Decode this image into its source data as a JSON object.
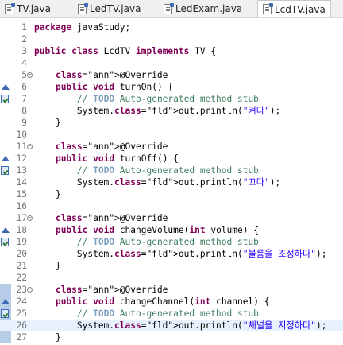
{
  "tabs": [
    {
      "label": "TV.java"
    },
    {
      "label": "LedTV.java"
    },
    {
      "label": "LedExam.java"
    },
    {
      "label": "LcdTV.java",
      "active": true
    }
  ],
  "lines": [
    {
      "num": "1",
      "code": "package javaStudy;"
    },
    {
      "num": "2",
      "code": ""
    },
    {
      "num": "3",
      "code": "public class LcdTV implements TV {"
    },
    {
      "num": "4",
      "code": ""
    },
    {
      "num": "5",
      "code": "    @Override"
    },
    {
      "num": "6",
      "code": "    public void turnOn() {"
    },
    {
      "num": "7",
      "code": "        // TODO Auto-generated method stub"
    },
    {
      "num": "8",
      "code": "        System.out.println(\"켜다\");"
    },
    {
      "num": "9",
      "code": "    }"
    },
    {
      "num": "10",
      "code": ""
    },
    {
      "num": "11",
      "code": "    @Override"
    },
    {
      "num": "12",
      "code": "    public void turnOff() {"
    },
    {
      "num": "13",
      "code": "        // TODO Auto-generated method stub"
    },
    {
      "num": "14",
      "code": "        System.out.println(\"끄다\");"
    },
    {
      "num": "15",
      "code": "    }"
    },
    {
      "num": "16",
      "code": ""
    },
    {
      "num": "17",
      "code": "    @Override"
    },
    {
      "num": "18",
      "code": "    public void changeVolume(int volume) {"
    },
    {
      "num": "19",
      "code": "        // TODO Auto-generated method stub"
    },
    {
      "num": "20",
      "code": "        System.out.println(\"볼륨을 조정하다\");"
    },
    {
      "num": "21",
      "code": "    }"
    },
    {
      "num": "22",
      "code": ""
    },
    {
      "num": "23",
      "code": "    @Override"
    },
    {
      "num": "24",
      "code": "    public void changeChannel(int channel) {"
    },
    {
      "num": "25",
      "code": "        // TODO Auto-generated method stub"
    },
    {
      "num": "26",
      "code": "        System.out.println(\"채널을 지정하다\");"
    },
    {
      "num": "27",
      "code": "    }"
    }
  ],
  "colors": {
    "keyword": "#7f0055",
    "comment": "#3f7f5f",
    "string": "#2a00ff",
    "annotation": "#646464",
    "line_number": "#787878",
    "current_line": "#e8f2fe"
  },
  "icons": {
    "override_marker": "override-triangle-icon",
    "task_marker": "task-icon",
    "fold_marker": "fold-minus-icon",
    "file_tab": "java-file-icon"
  }
}
